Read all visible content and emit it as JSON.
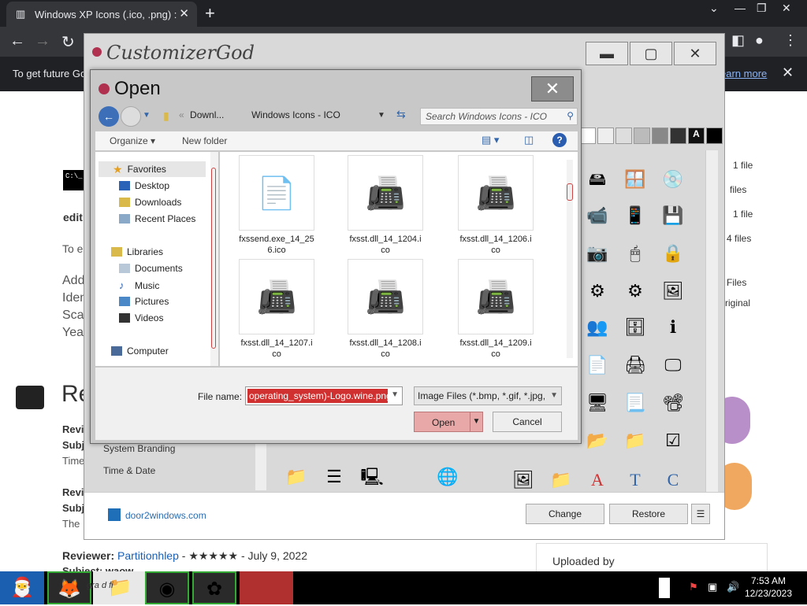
{
  "browser": {
    "tab_title": "Windows XP Icons (.ico, .png) : M",
    "tab_close": "✕",
    "new_tab": "+",
    "win_min": "—",
    "win_max": "❐",
    "win_close": "✕",
    "info_message": "To get future Go",
    "learn_more": "earn more",
    "info_close": "✕"
  },
  "page": {
    "edit_label": "edit",
    "to_text": "To e",
    "add_text": "Add",
    "iden_text": "Iden",
    "sca_text": "Sca",
    "yea_text": "Yea",
    "re_heading": "Re",
    "rev1": "Revi",
    "sub1": "Subj",
    "time1": "Time",
    "rev2": "Revi",
    "sub2": "Subj",
    "the2": "The",
    "reviewer_label": "Reviewer:",
    "reviewer_name": "Partitionhlep",
    "reviewer_rest": " - ★★★★★ - July 9, 2022",
    "subject_partial": "Subject: waow",
    "uploaded_by": "Uploaded by",
    "side_files": [
      "1 file",
      "files",
      "1 file",
      "4 files",
      "Files",
      "riginal"
    ]
  },
  "customizer": {
    "title": "CustomizerGod",
    "min": "▬",
    "max": "▢",
    "close": "✕",
    "list_items": [
      "System Branding",
      "Time & Date"
    ],
    "footer_link": "door2windows.com",
    "change": "Change",
    "restore": "Restore",
    "menu": "☰"
  },
  "dialog": {
    "title": "Open",
    "close": "✕",
    "path_parts": [
      "«",
      "Downl...",
      "›",
      "Windows Icons - ICO"
    ],
    "search_placeholder": "Search Windows Icons - ICO",
    "organize": "Organize",
    "new_folder": "New folder",
    "nav": {
      "favorites": "Favorites",
      "desktop": "Desktop",
      "downloads": "Downloads",
      "recent": "Recent Places",
      "libraries": "Libraries",
      "documents": "Documents",
      "music": "Music",
      "pictures": "Pictures",
      "videos": "Videos",
      "computer": "Computer"
    },
    "files": [
      {
        "name": "fxssend.exe_14_25\n6.ico"
      },
      {
        "name": "fxsst.dll_14_1204.i\nco"
      },
      {
        "name": "fxsst.dll_14_1206.i\nco"
      },
      {
        "name": "fxsst.dll_14_1207.i\nco"
      },
      {
        "name": "fxsst.dll_14_1208.i\nco"
      },
      {
        "name": "fxsst.dll_14_1209.i\nco"
      }
    ],
    "file_name_label": "File name:",
    "file_name_value": "operating_system)-Logo.wine.png",
    "filter": "Image Files (*.bmp, *.gif, *.jpg,",
    "open": "Open",
    "cancel": "Cancel"
  },
  "taskbar": {
    "clock_time": "7:53 AM",
    "clock_date": "12/23/2023",
    "task_text": "gra    d fi"
  }
}
